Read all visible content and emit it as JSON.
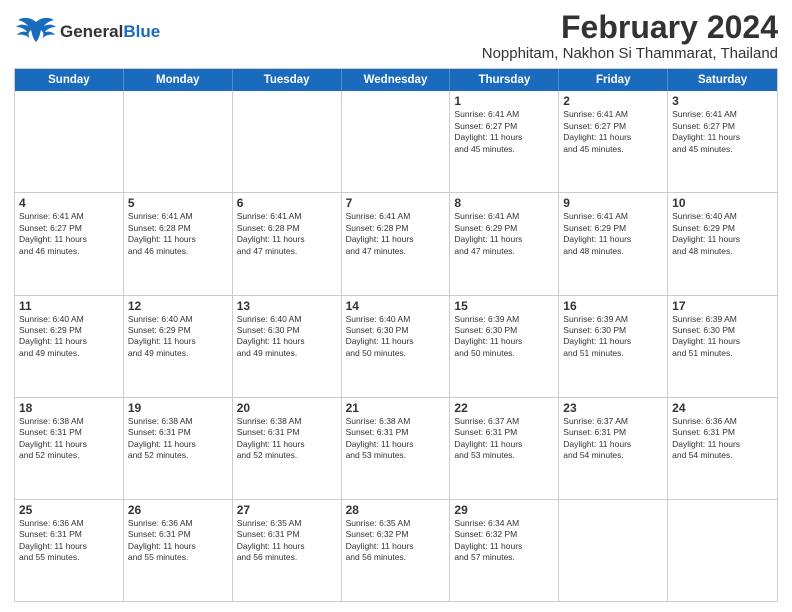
{
  "header": {
    "logo_general": "General",
    "logo_blue": "Blue",
    "main_title": "February 2024",
    "subtitle": "Nopphitam, Nakhon Si Thammarat, Thailand"
  },
  "days_of_week": [
    "Sunday",
    "Monday",
    "Tuesday",
    "Wednesday",
    "Thursday",
    "Friday",
    "Saturday"
  ],
  "weeks": [
    [
      {
        "day": "",
        "info": ""
      },
      {
        "day": "",
        "info": ""
      },
      {
        "day": "",
        "info": ""
      },
      {
        "day": "",
        "info": ""
      },
      {
        "day": "1",
        "info": "Sunrise: 6:41 AM\nSunset: 6:27 PM\nDaylight: 11 hours\nand 45 minutes."
      },
      {
        "day": "2",
        "info": "Sunrise: 6:41 AM\nSunset: 6:27 PM\nDaylight: 11 hours\nand 45 minutes."
      },
      {
        "day": "3",
        "info": "Sunrise: 6:41 AM\nSunset: 6:27 PM\nDaylight: 11 hours\nand 45 minutes."
      }
    ],
    [
      {
        "day": "4",
        "info": "Sunrise: 6:41 AM\nSunset: 6:27 PM\nDaylight: 11 hours\nand 46 minutes."
      },
      {
        "day": "5",
        "info": "Sunrise: 6:41 AM\nSunset: 6:28 PM\nDaylight: 11 hours\nand 46 minutes."
      },
      {
        "day": "6",
        "info": "Sunrise: 6:41 AM\nSunset: 6:28 PM\nDaylight: 11 hours\nand 47 minutes."
      },
      {
        "day": "7",
        "info": "Sunrise: 6:41 AM\nSunset: 6:28 PM\nDaylight: 11 hours\nand 47 minutes."
      },
      {
        "day": "8",
        "info": "Sunrise: 6:41 AM\nSunset: 6:29 PM\nDaylight: 11 hours\nand 47 minutes."
      },
      {
        "day": "9",
        "info": "Sunrise: 6:41 AM\nSunset: 6:29 PM\nDaylight: 11 hours\nand 48 minutes."
      },
      {
        "day": "10",
        "info": "Sunrise: 6:40 AM\nSunset: 6:29 PM\nDaylight: 11 hours\nand 48 minutes."
      }
    ],
    [
      {
        "day": "11",
        "info": "Sunrise: 6:40 AM\nSunset: 6:29 PM\nDaylight: 11 hours\nand 49 minutes."
      },
      {
        "day": "12",
        "info": "Sunrise: 6:40 AM\nSunset: 6:29 PM\nDaylight: 11 hours\nand 49 minutes."
      },
      {
        "day": "13",
        "info": "Sunrise: 6:40 AM\nSunset: 6:30 PM\nDaylight: 11 hours\nand 49 minutes."
      },
      {
        "day": "14",
        "info": "Sunrise: 6:40 AM\nSunset: 6:30 PM\nDaylight: 11 hours\nand 50 minutes."
      },
      {
        "day": "15",
        "info": "Sunrise: 6:39 AM\nSunset: 6:30 PM\nDaylight: 11 hours\nand 50 minutes."
      },
      {
        "day": "16",
        "info": "Sunrise: 6:39 AM\nSunset: 6:30 PM\nDaylight: 11 hours\nand 51 minutes."
      },
      {
        "day": "17",
        "info": "Sunrise: 6:39 AM\nSunset: 6:30 PM\nDaylight: 11 hours\nand 51 minutes."
      }
    ],
    [
      {
        "day": "18",
        "info": "Sunrise: 6:38 AM\nSunset: 6:31 PM\nDaylight: 11 hours\nand 52 minutes."
      },
      {
        "day": "19",
        "info": "Sunrise: 6:38 AM\nSunset: 6:31 PM\nDaylight: 11 hours\nand 52 minutes."
      },
      {
        "day": "20",
        "info": "Sunrise: 6:38 AM\nSunset: 6:31 PM\nDaylight: 11 hours\nand 52 minutes."
      },
      {
        "day": "21",
        "info": "Sunrise: 6:38 AM\nSunset: 6:31 PM\nDaylight: 11 hours\nand 53 minutes."
      },
      {
        "day": "22",
        "info": "Sunrise: 6:37 AM\nSunset: 6:31 PM\nDaylight: 11 hours\nand 53 minutes."
      },
      {
        "day": "23",
        "info": "Sunrise: 6:37 AM\nSunset: 6:31 PM\nDaylight: 11 hours\nand 54 minutes."
      },
      {
        "day": "24",
        "info": "Sunrise: 6:36 AM\nSunset: 6:31 PM\nDaylight: 11 hours\nand 54 minutes."
      }
    ],
    [
      {
        "day": "25",
        "info": "Sunrise: 6:36 AM\nSunset: 6:31 PM\nDaylight: 11 hours\nand 55 minutes."
      },
      {
        "day": "26",
        "info": "Sunrise: 6:36 AM\nSunset: 6:31 PM\nDaylight: 11 hours\nand 55 minutes."
      },
      {
        "day": "27",
        "info": "Sunrise: 6:35 AM\nSunset: 6:31 PM\nDaylight: 11 hours\nand 56 minutes."
      },
      {
        "day": "28",
        "info": "Sunrise: 6:35 AM\nSunset: 6:32 PM\nDaylight: 11 hours\nand 56 minutes."
      },
      {
        "day": "29",
        "info": "Sunrise: 6:34 AM\nSunset: 6:32 PM\nDaylight: 11 hours\nand 57 minutes."
      },
      {
        "day": "",
        "info": ""
      },
      {
        "day": "",
        "info": ""
      }
    ]
  ],
  "accent_color": "#1a6bbd"
}
